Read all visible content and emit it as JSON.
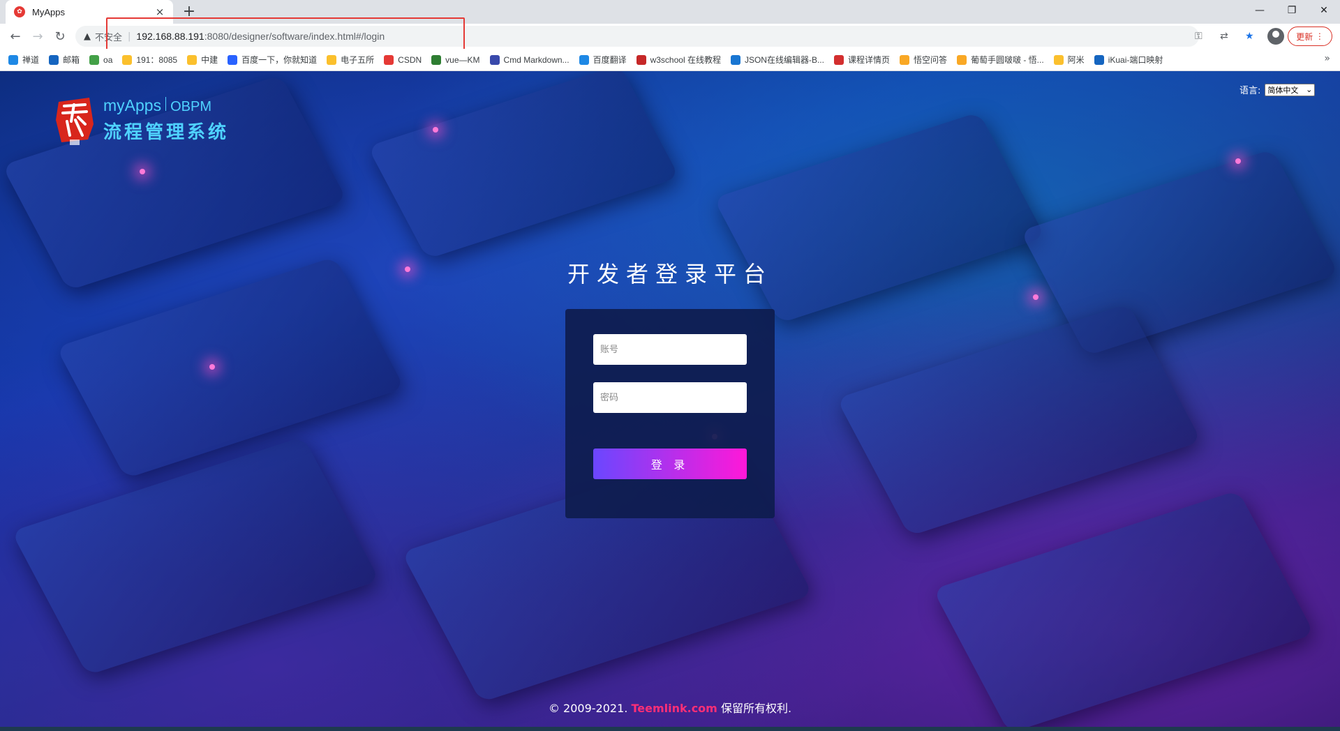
{
  "browser": {
    "tab": {
      "title": "MyApps",
      "favicon_text": "",
      "close": "×"
    },
    "new_tab": "+",
    "window_controls": {
      "minimize": "—",
      "restore": "❐",
      "close": "✕"
    },
    "nav": {
      "back": "←",
      "forward": "→",
      "reload": "↻"
    },
    "address": {
      "insecure_label": "不安全",
      "host": "192.168.88.191",
      "path": ":8080/designer/software/index.html#/login"
    },
    "update_label": "更新",
    "bookmarks": [
      {
        "label": "禅道",
        "color": "#1e88e5"
      },
      {
        "label": "邮箱",
        "color": "#1565c0"
      },
      {
        "label": "oa",
        "color": "#43a047"
      },
      {
        "label": "191：8085",
        "color": "#fbc02d"
      },
      {
        "label": "中建",
        "color": "#fbc02d"
      },
      {
        "label": "百度一下，你就知道",
        "color": "#2962ff"
      },
      {
        "label": "电子五所",
        "color": "#fbc02d"
      },
      {
        "label": "CSDN",
        "color": "#e53935"
      },
      {
        "label": "vue—KM",
        "color": "#2e7d32"
      },
      {
        "label": "Cmd Markdown...",
        "color": "#3949ab"
      },
      {
        "label": "百度翻译",
        "color": "#1e88e5"
      },
      {
        "label": "w3school 在线教程",
        "color": "#c62828"
      },
      {
        "label": "JSON在线编辑器-B...",
        "color": "#1976d2"
      },
      {
        "label": "课程详情页",
        "color": "#d32f2f"
      },
      {
        "label": "悟空问答",
        "color": "#f9a825"
      },
      {
        "label": "葡萄手圆啵啵 - 悟...",
        "color": "#f9a825"
      },
      {
        "label": "阿米",
        "color": "#fbc02d"
      },
      {
        "label": "iKuai-端口映射",
        "color": "#1565c0"
      }
    ],
    "bookmarks_more": "»"
  },
  "page": {
    "logo": {
      "brand": "myApps",
      "brand2": "OBPM",
      "subtitle": "流程管理系统"
    },
    "language": {
      "label": "语言:",
      "selected": "简体中文"
    },
    "title": "开发者登录平台",
    "form": {
      "username_placeholder": "账号",
      "password_placeholder": "密码",
      "login_label": "登 录"
    },
    "footer": {
      "prefix": "© 2009-2021.",
      "link": "Teemlink.com",
      "suffix": "保留所有权利."
    }
  }
}
